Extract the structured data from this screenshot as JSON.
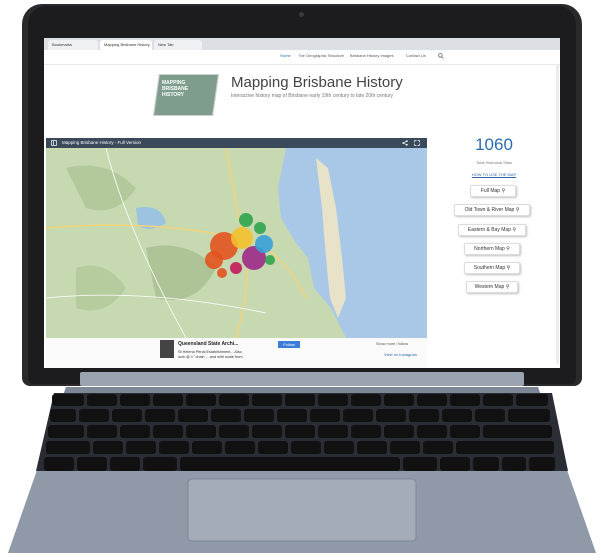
{
  "browser": {
    "tabs": [
      "Bookmarks",
      "Mapping Brisbane History",
      "New Tab"
    ]
  },
  "nav": {
    "items": [
      "Home",
      "The Geographic Structure",
      "Brisbane History Images",
      "Contact Us"
    ]
  },
  "header": {
    "logo_text": "MAPPING BRISBANE HISTORY",
    "title": "Mapping Brisbane History",
    "tagline": "Interactive history map of Brisbane early 19th century to late 20th century"
  },
  "map": {
    "title": "Mapping Brisbane History - Full Version"
  },
  "footer_post": {
    "author": "Queensland State Archi...",
    "text_line1": "St Helena Penal Establishment... Also",
    "text_line2": "look @ 1\" chain ... and with scale from",
    "follow": "Follow",
    "right_text": "Show more / follow",
    "link": "View on Instagram"
  },
  "stats": {
    "count": "1060",
    "count_label": "Total Historical Sites",
    "howto": "HOW TO USE THE MAP"
  },
  "map_buttons": [
    "Full Map",
    "Old Town & River Map",
    "Eastern & Bay Map",
    "Northern Map",
    "Southern Map",
    "Western Map"
  ],
  "colors": {
    "accent": "#2a6eb3",
    "map_header": "#3b4a5a",
    "water": "#a9c8e8",
    "land": "#bcd3a8",
    "laptop": "#1c1c1e",
    "keyboard_deck": "#8f99a8"
  },
  "icons": [
    "search-icon",
    "share-icon",
    "fullscreen-icon",
    "sidebar-icon"
  ]
}
